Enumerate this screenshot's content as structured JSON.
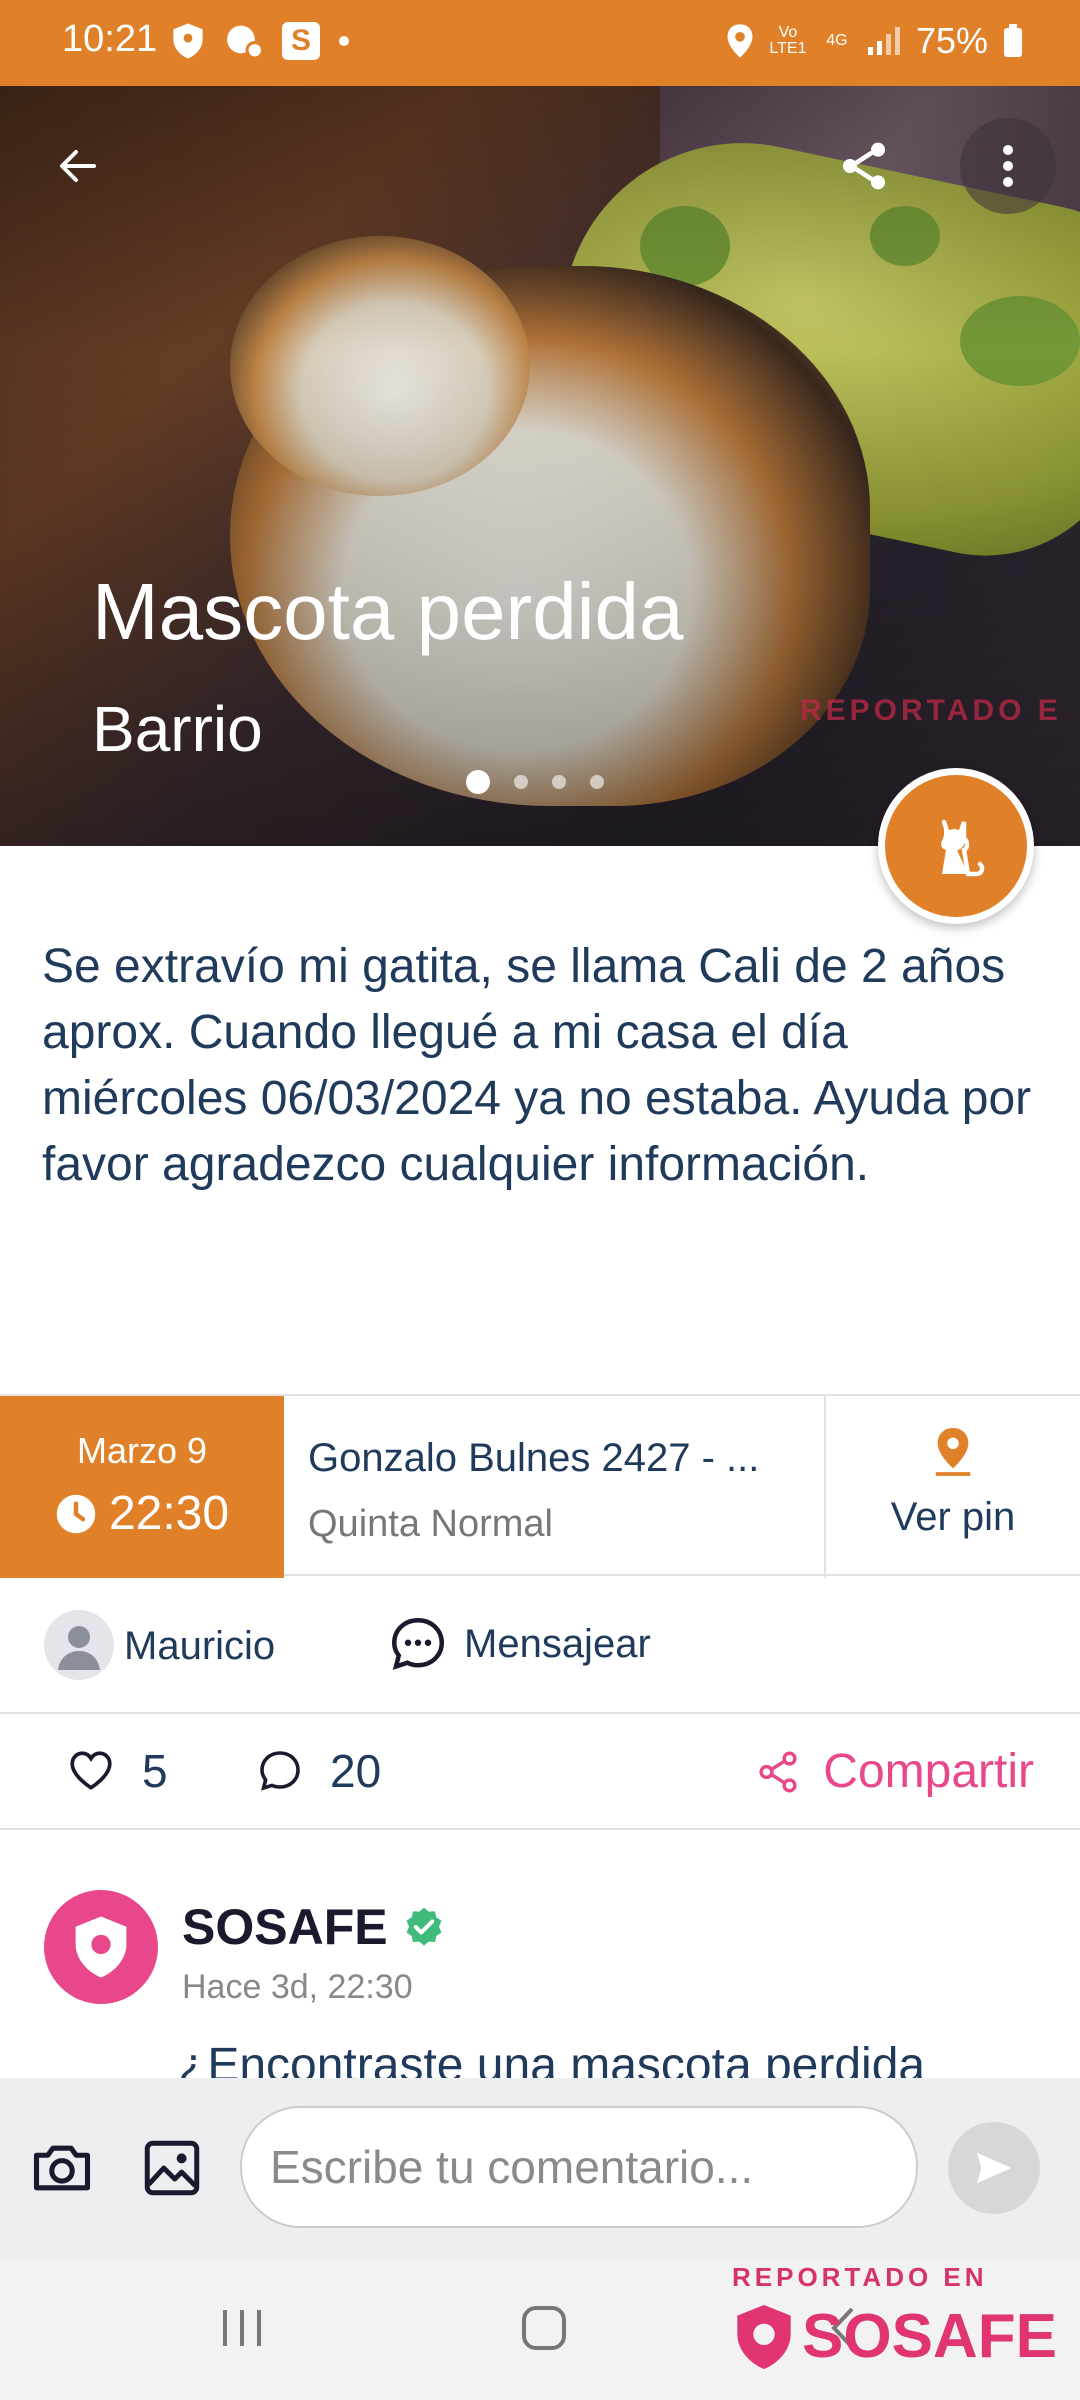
{
  "status_bar": {
    "time": "10:21",
    "battery": "75%",
    "network_top": "Vo LTE1",
    "network_type": "4G",
    "app_badge": "S",
    "colors": {
      "background": "#e0812a"
    }
  },
  "hero": {
    "title": "Mascota perdida",
    "subtitle": "Barrio",
    "watermark": "REPORTADO E",
    "carousel": {
      "count": 4,
      "active_index": 0
    },
    "icons": {
      "back": "arrow-left-icon",
      "share": "share-icon",
      "more": "more-vertical-icon",
      "category": "cat-icon"
    }
  },
  "description": "Se extravío mi gatita, se llama Cali de 2 años aprox. Cuando llegué a  mi casa el día miércoles 06/03/2024 ya no estaba. Ayuda por favor agradezco cualquier información.",
  "info": {
    "date": "Marzo 9",
    "time": "22:30",
    "street": "Gonzalo Bulnes  2427 - ...",
    "commune": "Quinta Normal",
    "pin_label": "Ver pin"
  },
  "user": {
    "name": "Mauricio",
    "message_label": "Mensajear"
  },
  "stats": {
    "likes": "5",
    "comments": "20",
    "share_label": "Compartir"
  },
  "comment": {
    "author": "SOSAFE",
    "time": "Hace 3d, 22:30",
    "text": "¿Encontraste una mascota perdida"
  },
  "input": {
    "placeholder": "Escribe tu comentario..."
  },
  "brand": {
    "reported_label": "REPORTADO EN",
    "name": "SOSAFE"
  },
  "colors": {
    "accent_orange": "#e0812a",
    "accent_pink": "#e8478b",
    "text_dark": "#1f3a5a"
  }
}
